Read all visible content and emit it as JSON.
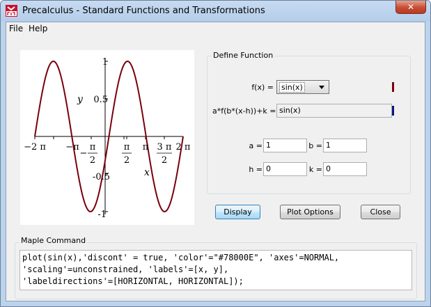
{
  "window": {
    "title": "Precalculus - Standard Functions and Transformations",
    "close_label": "✕"
  },
  "menu": [
    "File",
    "Help"
  ],
  "plot": {
    "y_label": "y",
    "x_label": "x",
    "curve_color": "#78000E",
    "y_ticks": [
      "1",
      "0.5",
      "-0.5",
      "-1"
    ],
    "x_ticks": [
      "−2 π",
      "−π",
      "π",
      "π",
      "3 π",
      "2 π"
    ],
    "x_tick_denoms": [
      "2",
      "2",
      "2"
    ],
    "x_tick_minus": "−"
  },
  "define_function": {
    "title": "Define Function",
    "fx_label": "f(x) =",
    "fx_selected": "sin(x)",
    "transform_label": "a*f(b*(x-h))+k =",
    "transform_value": "sin(x)",
    "fx_marker_color": "#78000E",
    "transform_marker_color": "#0a1a7a",
    "a_label": "a =",
    "a_value": "1",
    "b_label": "b =",
    "b_value": "1",
    "h_label": "h =",
    "h_value": "0",
    "k_label": "k =",
    "k_value": "0"
  },
  "buttons": {
    "display": "Display",
    "plot_options": "Plot Options",
    "close": "Close"
  },
  "maple_command": {
    "title": "Maple Command",
    "lines": [
      "plot(sin(x),'discont' = true, 'color'=\"#78000E\", 'axes'=NORMAL,",
      "'scaling'=unconstrained, 'labels'=[x, y],",
      "'labeldirections'=[HORIZONTAL, HORIZONTAL]);"
    ]
  }
}
